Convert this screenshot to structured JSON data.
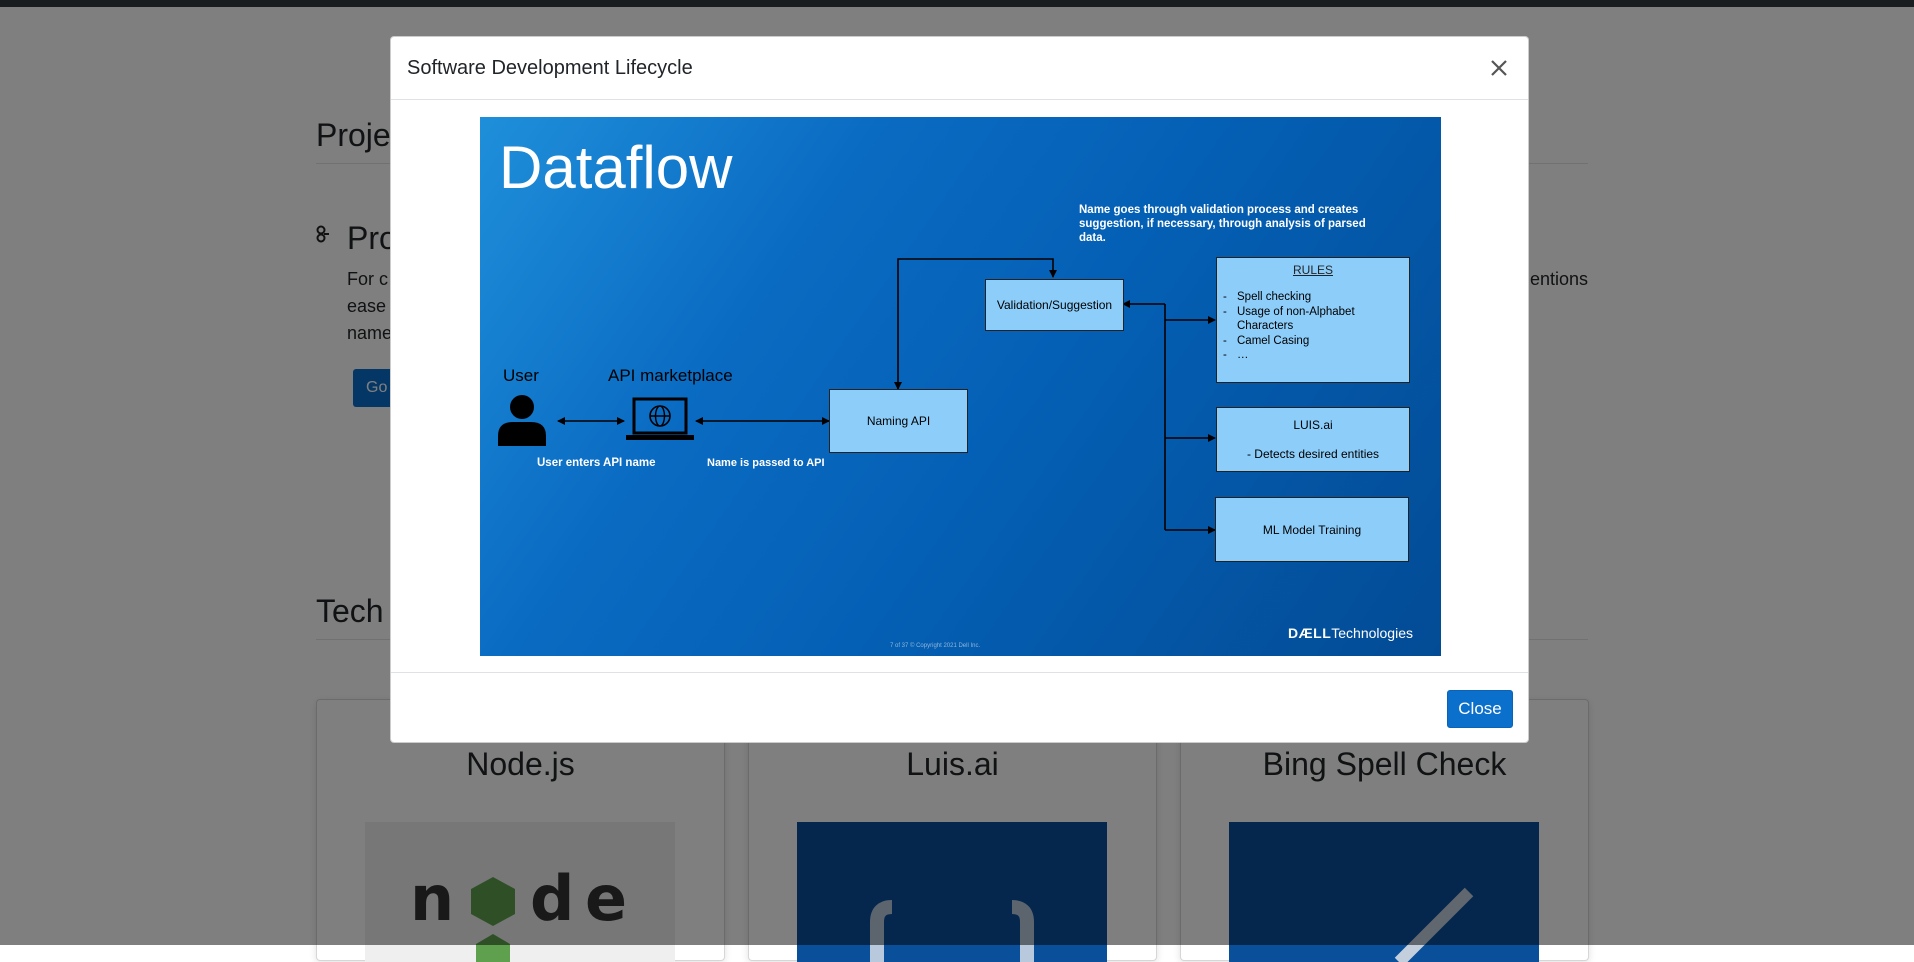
{
  "background": {
    "section_title": "Proje",
    "subsection_title": "Pro",
    "paragraph_lines": [
      "For c",
      "ease",
      "name"
    ],
    "paragraph_right": "entions",
    "button_label": "Go",
    "tech_title": "Tech",
    "cards": [
      {
        "title": "Node.js"
      },
      {
        "title": "Luis.ai"
      },
      {
        "title": "Bing Spell Check"
      }
    ]
  },
  "modal": {
    "title": "Software Development Lifecycle",
    "close_icon": "close-icon",
    "close_button_label": "Close",
    "slide": {
      "title": "Dataflow",
      "user_label": "User",
      "api_marketplace_label": "API marketplace",
      "user_caption": "User enters API name",
      "pass_caption": "Name is passed to API",
      "naming_api": "Naming API",
      "validation": "Validation/Suggestion",
      "description": "Name goes through validation process and creates suggestion, if necessary, through analysis of parsed data.",
      "rules": {
        "title": "RULES",
        "items": [
          "Spell checking",
          "Usage of non-Alphabet Characters",
          "Camel Casing",
          "…"
        ]
      },
      "luis": {
        "title": "LUIS.ai",
        "detail": "- Detects desired entities"
      },
      "ml": "ML Model Training",
      "footer": "7 of 37     © Copyright 2021 Dell Inc.",
      "brand_bold": "DÆLL",
      "brand_rest": "Technologies"
    }
  }
}
